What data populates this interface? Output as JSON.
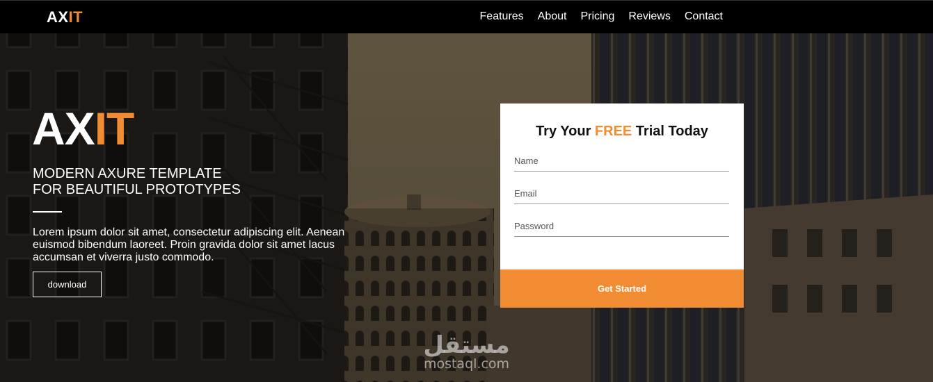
{
  "brand": {
    "logo_part1": "AX",
    "logo_part2": "IT",
    "accent": "#f28c32"
  },
  "nav": {
    "links": [
      "Features",
      "About",
      "Pricing",
      "Reviews",
      "Contact"
    ]
  },
  "hero": {
    "logo_part1": "AX",
    "logo_part2": "IT",
    "tagline_line1": "MODERN AXURE TEMPLATE",
    "tagline_line2": "FOR BEAUTIFUL PROTOTYPES",
    "body": "Lorem ipsum dolor sit amet, consectetur adipiscing elit. Aenean euismod bibendum laoreet. Proin gravida dolor sit amet lacus accumsan et viverra justo commodo.",
    "download_label": "download"
  },
  "signup": {
    "title_before": "Try Your ",
    "title_highlight": "FREE",
    "title_after": " Trial Today",
    "name_placeholder": "Name",
    "email_placeholder": "Email",
    "password_placeholder": "Password",
    "submit_label": "Get Started"
  },
  "watermark": {
    "arabic": "مستقل",
    "latin": "mostaql.com"
  }
}
